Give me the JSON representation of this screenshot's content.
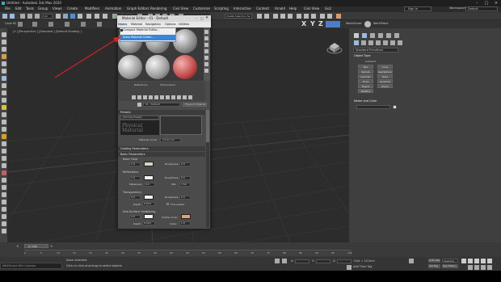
{
  "app": {
    "title": "Untitled - Autodesk 3ds Max 2020",
    "menu": [
      "File",
      "Edit",
      "Tools",
      "Group",
      "Views",
      "Create",
      "Modifiers",
      "Animation",
      "Graph Editors",
      "Rendering",
      "Civil View",
      "Customize",
      "Scripting",
      "Interactive",
      "Content",
      "Arnold",
      "Help",
      "Civil View",
      "Go2"
    ],
    "signin": "Sign In",
    "workspaces_label": "Workspaces:",
    "workspace": "Default",
    "create_selection_set": "Create Selection Se",
    "view_dropdown": "View",
    "workplane": "WorkPlane",
    "mesh_label": "MeshSmart",
    "axis_labels": [
      "X",
      "Y",
      "Z"
    ]
  },
  "viewport": {
    "label": "[+] [Perspective ] [Standard ] [Default Shading ]"
  },
  "material_editor": {
    "title": "Material Editor - 01 - Default",
    "menu": [
      "Modes",
      "Material",
      "Navigation",
      "Options",
      "Utilities"
    ],
    "dropdown": [
      "Compact Material Editor...",
      "Slate Material Editor..."
    ],
    "highlighted": "Slate Material Editor...",
    "slot_name": "01 - Default",
    "material_type": "Physical Material",
    "reflections_label": "Reflections",
    "transmission_label": "Transmission",
    "presets_header": "Presets",
    "preset_value": "(Choose Preset)",
    "material_logo": "Physical Material",
    "material_mode_label": "Material mode:",
    "material_mode_value": "Advanced",
    "coating_header": "Coating Parameters",
    "basic_header": "Basic Parameters",
    "base_color_label": "Base Color",
    "base_value": "1.0",
    "roughness_label": "Roughness:",
    "roughness_value": "0.0",
    "reflections_section": "Reflections",
    "refl_value": "1.0",
    "refl_roughness_value": "0.0",
    "ior_label": "IOR:",
    "ior_value": "1.52",
    "metalness_label": "Metalness:",
    "metalness_value": "0.0",
    "transparency_label": "Transparency",
    "trans_value": "0.0",
    "trans_roughness_value": "0.0",
    "depth_label": "Depth:",
    "depth_value": "0.0cm",
    "thin_walled": "Thin-walled",
    "sss_label": "Sub-Surface Scattering",
    "sss_value": "0.0",
    "scatter_color_label": "Scatter Color:",
    "scale_label": "Scale:",
    "scale_value": "1.0",
    "sss_depth_value": "0.0cm"
  },
  "command_panel": {
    "dropdown": "Standard Primitives",
    "object_type_header": "Object Type",
    "autogrid": "AutoGrid",
    "buttons": [
      "Box",
      "Cone",
      "Sphere",
      "GeoSphere",
      "Cylinder",
      "Tube",
      "Torus",
      "Pyramid",
      "Teapot",
      "Plane",
      "TextPlus"
    ],
    "name_color_header": "Name and Color"
  },
  "timeline": {
    "frame": "0 / 100",
    "ticks": [
      "0",
      "5",
      "10",
      "15",
      "20",
      "25",
      "30",
      "35",
      "40",
      "45",
      "50",
      "55",
      "60",
      "65",
      "70",
      "75",
      "80",
      "85",
      "90",
      "95",
      "100"
    ]
  },
  "status": {
    "maxscript": "MAXScript Mini Listener",
    "selected": "None Selected",
    "hint": "Click or click-and-drag to select objects",
    "x_label": "X:",
    "y_label": "Y:",
    "z_label": "Z:",
    "grid": "Grid = 10.0cm",
    "add_time_tag": "Add Time Tag",
    "autokey": "Auto Key",
    "setkey": "Set Key",
    "selected_dd": "Selected",
    "key_filters": "Key Filters..."
  },
  "colors": {
    "accent": "#3a86d6",
    "red_arrow": "#d6202a",
    "scatter_color": "#e8a070",
    "base_color": "#d8d0c0"
  }
}
